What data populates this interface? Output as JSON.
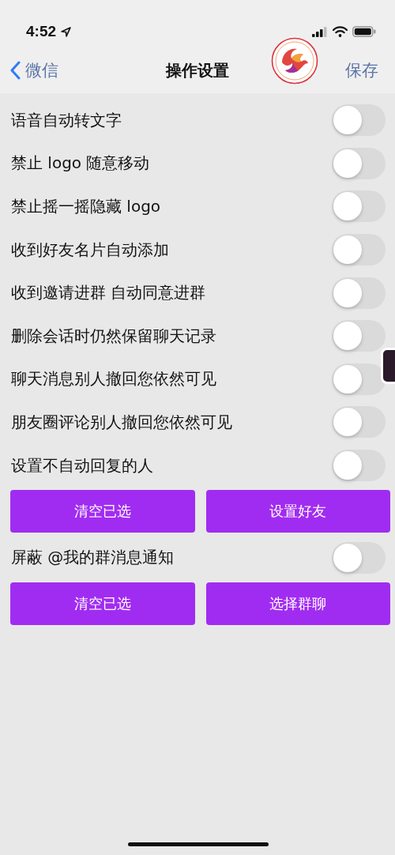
{
  "status_bar": {
    "time": "4:52"
  },
  "nav": {
    "back": "微信",
    "title": "操作设置",
    "action": "保存"
  },
  "items": [
    {
      "kind": "toggle",
      "label": "语音自动转文字",
      "on": false
    },
    {
      "kind": "toggle",
      "label": "禁止 logo 随意移动",
      "on": false
    },
    {
      "kind": "toggle",
      "label": "禁止摇一摇隐藏 logo",
      "on": false
    },
    {
      "kind": "toggle",
      "label": "收到好友名片自动添加",
      "on": false
    },
    {
      "kind": "toggle",
      "label": "收到邀请进群 自动同意进群",
      "on": false
    },
    {
      "kind": "toggle",
      "label": "删除会话时仍然保留聊天记录",
      "on": false
    },
    {
      "kind": "toggle",
      "label": "聊天消息别人撤回您依然可见",
      "on": false
    },
    {
      "kind": "toggle",
      "label": "朋友圈评论别人撤回您依然可见",
      "on": false
    },
    {
      "kind": "toggle",
      "label": "设置不自动回复的人",
      "on": false
    },
    {
      "kind": "buttons",
      "buttons": [
        "清空已选",
        "设置好友"
      ]
    },
    {
      "kind": "toggle",
      "label": "屏蔽 @我的群消息通知",
      "on": false
    },
    {
      "kind": "buttons",
      "buttons": [
        "清空已选",
        "选择群聊"
      ]
    }
  ]
}
